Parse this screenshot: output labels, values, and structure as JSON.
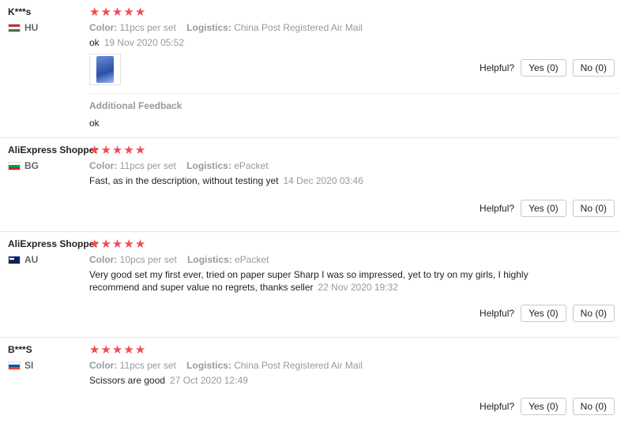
{
  "reviews": [
    {
      "user": "K***s",
      "country": "HU",
      "stars": 5,
      "color_label": "Color:",
      "color_value": "11pcs per set",
      "logistics_label": "Logistics:",
      "logistics_value": "China Post Registered Air Mail",
      "text": "ok",
      "date": "19 Nov 2020 05:52",
      "additional_title": "Additional Feedback",
      "additional_text": "ok",
      "helpful_label": "Helpful?",
      "yes_label": "Yes (0)",
      "no_label": "No (0)"
    },
    {
      "user": "AliExpress Shopper",
      "country": "BG",
      "stars": 5,
      "color_label": "Color:",
      "color_value": "11pcs per set",
      "logistics_label": "Logistics:",
      "logistics_value": "ePacket",
      "text": "Fast, as in the description, without testing yet",
      "date": "14 Dec 2020 03:46",
      "helpful_label": "Helpful?",
      "yes_label": "Yes (0)",
      "no_label": "No (0)"
    },
    {
      "user": "AliExpress Shopper",
      "country": "AU",
      "stars": 5,
      "color_label": "Color:",
      "color_value": "10pcs per set",
      "logistics_label": "Logistics:",
      "logistics_value": "ePacket",
      "text": "Very good set my first ever, tried on paper super Sharp I was so impressed, yet to try on my girls, I highly recommend and super value no regrets, thanks seller",
      "date": "22 Nov 2020 19:32",
      "helpful_label": "Helpful?",
      "yes_label": "Yes (0)",
      "no_label": "No (0)"
    },
    {
      "user": "B***S",
      "country": "SI",
      "stars": 5,
      "color_label": "Color:",
      "color_value": "11pcs per set",
      "logistics_label": "Logistics:",
      "logistics_value": "China Post Registered Air Mail",
      "text": "Scissors are good",
      "date": "27 Oct 2020 12:49",
      "helpful_label": "Helpful?",
      "yes_label": "Yes (0)",
      "no_label": "No (0)"
    }
  ],
  "colors": {
    "star": "#f44b4f",
    "muted": "#999999"
  }
}
